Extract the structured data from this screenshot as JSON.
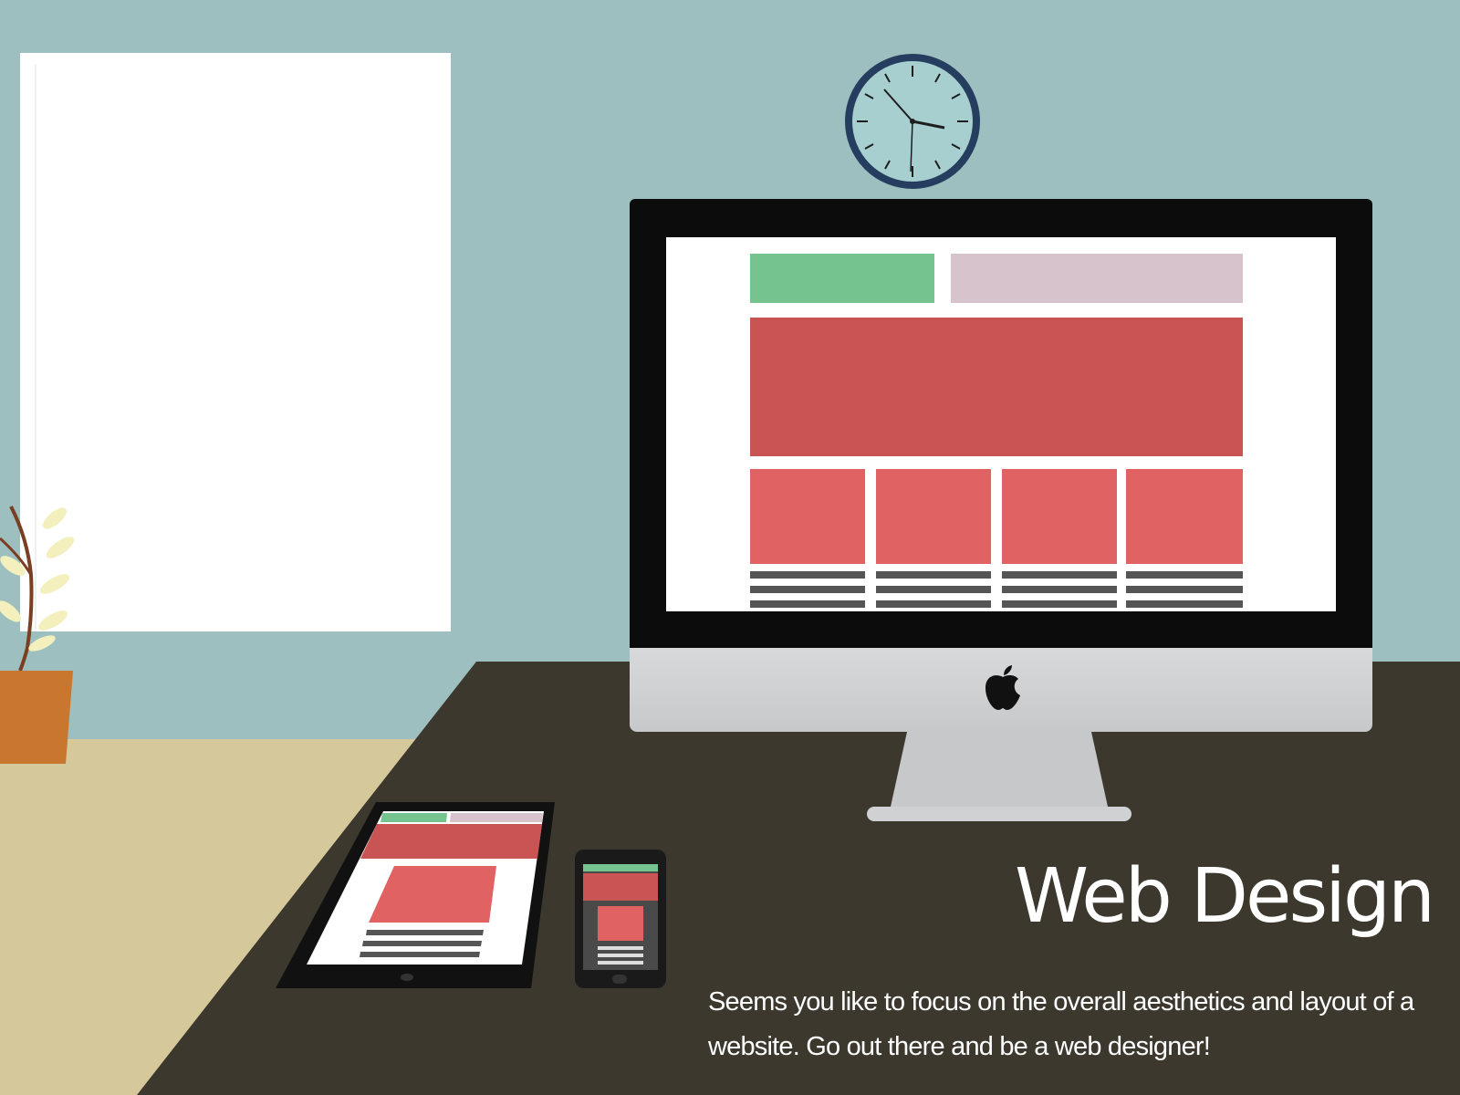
{
  "hero": {
    "title": "Web Design",
    "description": "Seems you like to focus on the overall aesthetics and layout of a website. Go out there and be a web designer!"
  },
  "colors": {
    "wall": "#9dbfbf",
    "floor": "#d5c89a",
    "desk": "#3c382d",
    "window": "#ffffff",
    "accent_green": "#75c38f",
    "accent_pink": "#d7c3cb",
    "banner_red": "#c85553",
    "tile_red": "#e06262",
    "text_bar": "#555555",
    "clock_rim": "#253d5e",
    "clock_face": "#a7cfcf",
    "pot": "#c9772f",
    "leaf": "#f3f0be"
  },
  "icons": [
    "wall-clock-icon",
    "apple-logo-icon",
    "plant-icon"
  ]
}
